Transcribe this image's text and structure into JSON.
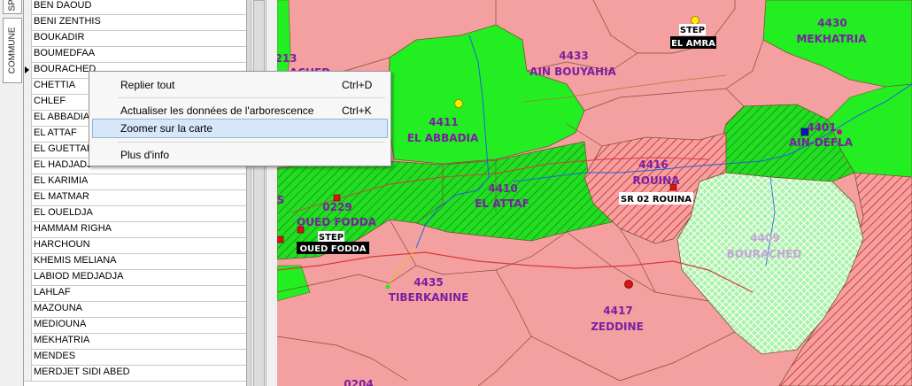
{
  "side_tabs": {
    "top": "SP",
    "commune": "COMMUNE"
  },
  "communes": [
    "BEN DAOUD",
    "BENI ZENTHIS",
    "BOUKADIR",
    "BOUMEDFAA",
    "BOURACHED",
    "CHETTIA",
    "CHLEF",
    "EL ABBADIA",
    "EL ATTAF",
    "EL GUETTAR",
    "EL HADJADJ",
    "EL KARIMIA",
    "EL MATMAR",
    "EL OUELDJA",
    "HAMMAM RIGHA",
    "HARCHOUN",
    "KHEMIS MELIANA",
    "LABIOD MEDJADJA",
    "LAHLAF",
    "MAZOUNA",
    "MEDIOUNA",
    "MEKHATRIA",
    "MENDES",
    "MERDJET SIDI ABED"
  ],
  "selected_commune": "BOURACHED",
  "context_menu": {
    "items": [
      {
        "label": "Replier tout",
        "shortcut": "Ctrl+D"
      },
      {
        "label": "Actualiser les données de l'arborescence",
        "shortcut": "Ctrl+K"
      },
      {
        "label": "Zoomer sur la carte",
        "shortcut": ""
      },
      {
        "label": "Plus d'info",
        "shortcut": ""
      }
    ],
    "highlighted": "Zoomer sur la carte"
  },
  "map": {
    "colors": {
      "pink": "#f5a0a0",
      "green": "#22ee22",
      "dark_green": "#1aa81a",
      "light_green": "#a8f5a8",
      "hatch_red": "#d01818",
      "road": "#d63a3a",
      "river": "#2060e0",
      "purple_label": "#7a1fa2"
    },
    "commune_labels": [
      {
        "code": "4430",
        "name": "MEKHATRIA"
      },
      {
        "code": "4433",
        "name": "AIN BOUYAHIA"
      },
      {
        "code": "4411",
        "name": "EL ABBADIA"
      },
      {
        "code": "4401",
        "name": "AIN-DEFLA"
      },
      {
        "code": "4416",
        "name": "ROUINA"
      },
      {
        "code": "4410",
        "name": "EL ATTAF"
      },
      {
        "code": "0229",
        "name": "OUED FODDA"
      },
      {
        "code": "4409",
        "name": "BOURACHED"
      },
      {
        "code": "4435",
        "name": "TIBERKANINE"
      },
      {
        "code": "4417",
        "name": "ZEDDINE"
      }
    ],
    "partial_labels": [
      "213",
      "ACHED",
      "S",
      "0204"
    ],
    "stations": [
      {
        "line1": "STEP",
        "line2": "EL AMRA"
      },
      {
        "line1": "STEP",
        "line2": "OUED FODDA"
      },
      {
        "line1": "SR 02 ROUINA",
        "line2": ""
      }
    ]
  }
}
